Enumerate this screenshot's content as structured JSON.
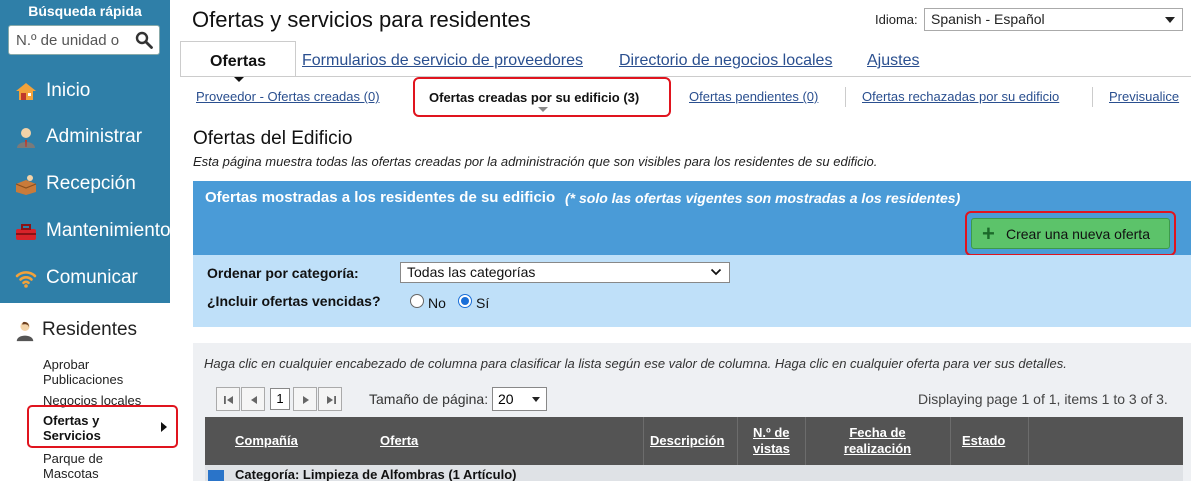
{
  "sidebar": {
    "quick_search_title": "Búsqueda rápida",
    "quick_search_placeholder": "N.º de unidad o",
    "nav": [
      {
        "label": "Inicio",
        "icon": "house-icon"
      },
      {
        "label": "Administrar",
        "icon": "manager-icon"
      },
      {
        "label": "Recepción",
        "icon": "package-icon"
      },
      {
        "label": "Mantenimiento",
        "icon": "toolbox-icon"
      },
      {
        "label": "Comunicar",
        "icon": "wifi-icon"
      }
    ],
    "residents": {
      "label": "Residentes",
      "icon": "resident-icon",
      "items": [
        {
          "label": "Aprobar Publicaciones"
        },
        {
          "label": "Negocios locales"
        },
        {
          "label": "Ofertas y Servicios",
          "active": true
        },
        {
          "label": "Parque de Mascotas"
        }
      ]
    }
  },
  "header": {
    "title": "Ofertas y servicios para residentes",
    "language_label": "Idioma:",
    "language_value": "Spanish - Español"
  },
  "tabs": [
    {
      "label": "Ofertas",
      "active": true
    },
    {
      "label": "Formularios de servicio de proveedores"
    },
    {
      "label": "Directorio de negocios locales"
    },
    {
      "label": "Ajustes"
    }
  ],
  "subtabs": [
    {
      "label": "Proveedor - Ofertas creadas (0)"
    },
    {
      "label": "Ofertas creadas por su edificio (3)",
      "active": true
    },
    {
      "label": "Ofertas pendientes (0)"
    },
    {
      "label": "Ofertas rechazadas por su edificio"
    },
    {
      "label": "Previsualice"
    }
  ],
  "section": {
    "title": "Ofertas del Edificio",
    "description": "Esta página muestra todas las ofertas creadas por la administración que son visibles para los residentes de su edificio."
  },
  "panel": {
    "heading": "Ofertas mostradas a los residentes de su edificio",
    "note": "(* solo las ofertas vigentes son mostradas a los residentes)",
    "create_button": "Crear una nueva oferta",
    "category_label": "Ordenar por categoría:",
    "category_value": "Todas las categorías",
    "expired_label": "¿Incluir ofertas vencidas?",
    "expired_no": "No",
    "expired_yes": "Sí",
    "expired_selected": "Sí"
  },
  "grid": {
    "hint": "Haga clic en cualquier encabezado de columna para clasificar la lista según ese valor de columna. Haga clic en cualquier oferta para ver sus detalles.",
    "current_page": "1",
    "page_size_label": "Tamaño de página:",
    "page_size_value": "20",
    "page_info": "Displaying page 1 of 1, items 1 to 3 of 3.",
    "columns": {
      "company": "Compañía",
      "offer": "Oferta",
      "description": "Descripción",
      "views_1": "N.º de",
      "views_2": "vistas",
      "date_1": "Fecha de",
      "date_2": "realización",
      "status": "Estado"
    },
    "first_row_text": "Categoría: Limpieza de Alfombras (1 Artículo)"
  },
  "colors": {
    "sidebar_bg": "#2f7fa8",
    "panel_header": "#4a9bd7",
    "panel_body": "#bfe0f9",
    "create_button": "#5cc36a",
    "highlight_border": "#e0141e",
    "grid_header": "#545454"
  }
}
